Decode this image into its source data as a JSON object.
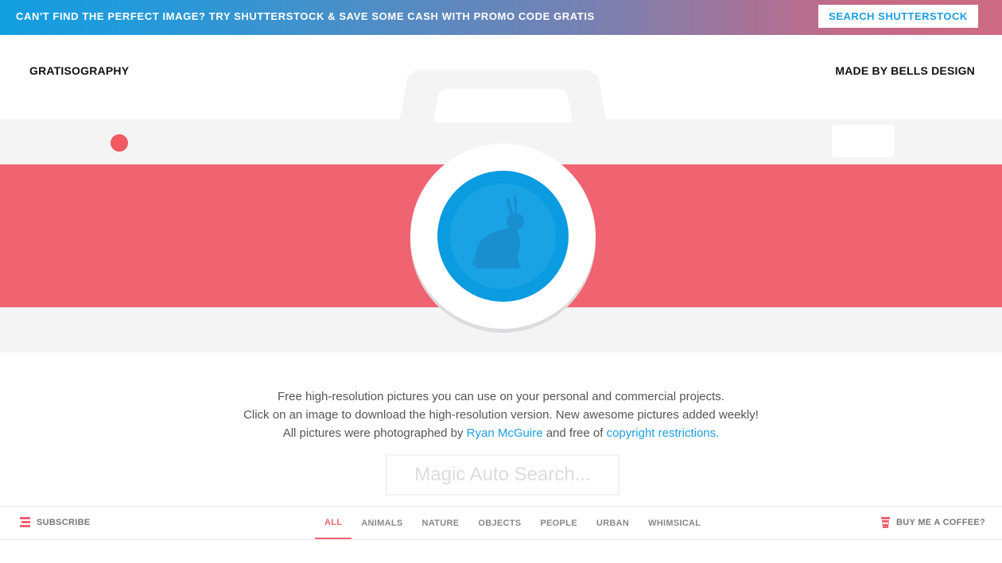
{
  "promo": {
    "text": "CAN'T FIND THE PERFECT IMAGE? TRY SHUTTERSTOCK & SAVE SOME CASH WITH PROMO CODE GRATIS",
    "button_label": "SEARCH SHUTTERSTOCK"
  },
  "header": {
    "site_title": "GRATISOGRAPHY",
    "made_by": "MADE BY BELLS DESIGN"
  },
  "hero": {
    "icon": "camera-illustration",
    "lens_icon": "rabbit-icon",
    "colors": {
      "stripe": "#f06472",
      "lens": "#0a9be0",
      "body": "#f4f4f5"
    }
  },
  "intro": {
    "line1": "Free high-resolution pictures you can use on your personal and commercial projects.",
    "line2": "Click on an image to download the high-resolution version. New awesome pictures added weekly!",
    "line3_prefix": "All pictures were photographed by",
    "author_link": "Ryan McGuire",
    "line3_middle": "and free of",
    "copyright_link": "copyright restrictions."
  },
  "search": {
    "placeholder": "Magic Auto Search...",
    "value": ""
  },
  "nav": {
    "subscribe_label": "SUBSCRIBE",
    "subscribe_icon": "stack-icon",
    "coffee_label": "BUY ME A COFFEE?",
    "coffee_icon": "coffee-cup-icon",
    "categories": [
      {
        "label": "ALL",
        "active": true
      },
      {
        "label": "ANIMALS",
        "active": false
      },
      {
        "label": "NATURE",
        "active": false
      },
      {
        "label": "OBJECTS",
        "active": false
      },
      {
        "label": "PEOPLE",
        "active": false
      },
      {
        "label": "URBAN",
        "active": false
      },
      {
        "label": "WHIMSICAL",
        "active": false
      }
    ],
    "accent_color": "#f06472"
  }
}
